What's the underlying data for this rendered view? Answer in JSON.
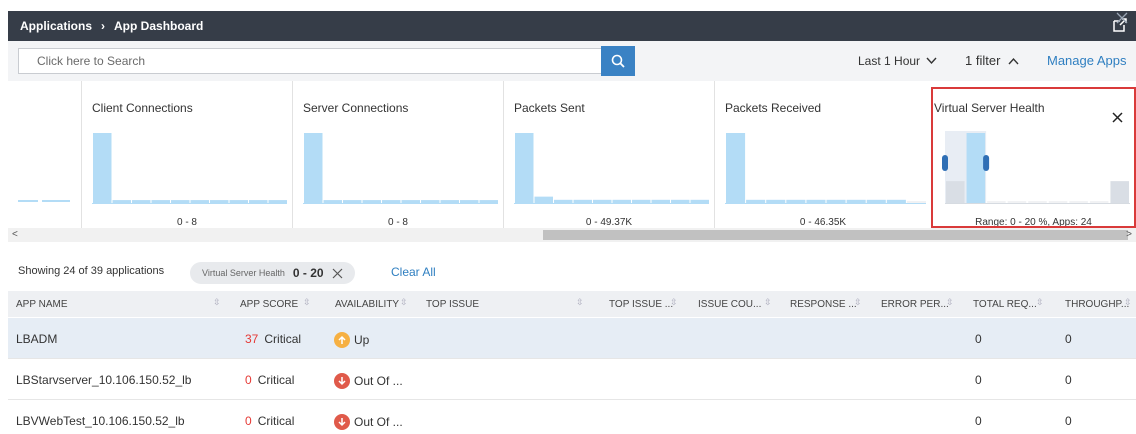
{
  "header": {
    "breadcrumb_root": "Applications",
    "breadcrumb_sep": "›",
    "breadcrumb_current": "App Dashboard",
    "popout_icon": "external-link-icon"
  },
  "search": {
    "placeholder": "Click here to Search",
    "button_icon": "search-icon"
  },
  "toolbar": {
    "time_range": "Last 1 Hour",
    "filter_label": "1 filter",
    "manage_apps": "Manage Apps"
  },
  "charts": [
    {
      "title": "",
      "range": ""
    },
    {
      "title": "Client Connections",
      "range": "0 - 8"
    },
    {
      "title": "Server Connections",
      "range": "0 - 8"
    },
    {
      "title": "Packets Sent",
      "range": "0 - 49.37K"
    },
    {
      "title": "Packets Received",
      "range": "0 - 46.35K"
    },
    {
      "title": "Virtual Server Health",
      "range": "Range: 0 - 20 %, Apps: 24"
    }
  ],
  "chart_data": [
    {
      "type": "bar",
      "title": "Client Connections",
      "values": [
        24,
        1,
        1,
        1,
        1,
        1,
        1,
        1,
        1,
        1
      ],
      "range": "0 - 8"
    },
    {
      "type": "bar",
      "title": "Server Connections",
      "values": [
        24,
        1,
        1,
        1,
        1,
        1,
        1,
        1,
        1,
        1
      ],
      "range": "0 - 8"
    },
    {
      "type": "bar",
      "title": "Packets Sent",
      "values": [
        22,
        2,
        1,
        1,
        1,
        1,
        1,
        1,
        1,
        1
      ],
      "range": "0 - 49.37K"
    },
    {
      "type": "bar",
      "title": "Packets Received",
      "values": [
        22,
        1,
        1,
        1,
        1,
        1,
        1,
        1,
        1,
        0
      ],
      "range": "0 - 46.35K"
    },
    {
      "type": "bar",
      "title": "Virtual Server Health",
      "values": [
        5,
        16,
        0,
        0,
        0,
        0,
        0,
        0,
        5
      ],
      "range": "Range: 0 - 20 %, Apps: 24",
      "selected_range": [
        0,
        20
      ]
    }
  ],
  "filter_summary": {
    "showing": "Showing 24 of 39 applications",
    "chip_label": "Virtual Server Health",
    "chip_value": "0 - 20",
    "clear_all": "Clear All"
  },
  "table": {
    "columns": [
      "APP NAME",
      "APP SCORE",
      "AVAILABILITY",
      "TOP ISSUE",
      "TOP ISSUE ...",
      "ISSUE COU...",
      "RESPONSE ...",
      "ERROR PER...",
      "TOTAL REQ...",
      "THROUGHP..."
    ],
    "rows": [
      {
        "app_name": "LBADM",
        "score": "37",
        "score_label": "Critical",
        "availability": "Up",
        "availability_status": "up",
        "total_req": "0",
        "throughput": "0"
      },
      {
        "app_name": "LBStarvserver_10.106.150.52_lb",
        "score": "0",
        "score_label": "Critical",
        "availability": "Out Of ...",
        "availability_status": "down",
        "total_req": "0",
        "throughput": "0"
      },
      {
        "app_name": "LBVWebTest_10.106.150.52_lb",
        "score": "0",
        "score_label": "Critical",
        "availability": "Out Of ...",
        "availability_status": "down",
        "total_req": "0",
        "throughput": "0"
      }
    ]
  },
  "colors": {
    "header_bg": "#363d48",
    "accent": "#3a82c4",
    "link": "#2f7fc1",
    "bar": "#b3dcf6",
    "critical": "#e53935",
    "highlight_border": "#d93a3a"
  }
}
